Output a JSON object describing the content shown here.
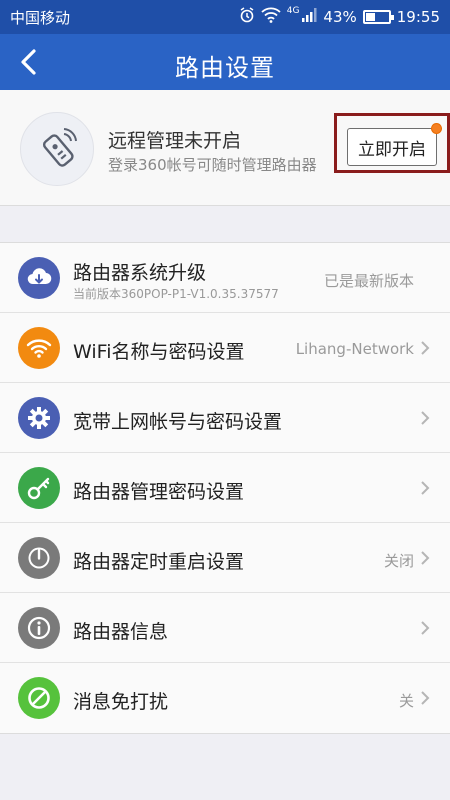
{
  "status_bar": {
    "carrier": "中国移动",
    "network": "4G",
    "battery": "43%",
    "time": "19:55"
  },
  "header": {
    "title": "路由设置"
  },
  "remote": {
    "title": "远程管理未开启",
    "subtitle": "登录360帐号可随时管理路由器",
    "button_label": "立即开启"
  },
  "settings": {
    "upgrade": {
      "label": "路由器系统升级",
      "sublabel": "当前版本360POP-P1-V1.0.35.37577",
      "value": "已是最新版本"
    },
    "wifi": {
      "label": "WiFi名称与密码设置",
      "value": "Lihang-Network"
    },
    "broadband": {
      "label": "宽带上网帐号与密码设置",
      "value": ""
    },
    "admin_password": {
      "label": "路由器管理密码设置",
      "value": ""
    },
    "scheduled_reboot": {
      "label": "路由器定时重启设置",
      "value": "关闭"
    },
    "router_info": {
      "label": "路由器信息",
      "value": ""
    },
    "dnd": {
      "label": "消息免打扰",
      "value": "关"
    }
  },
  "colors": {
    "header_blue": "#2a63c5",
    "status_blue": "#1f4fa8",
    "upgrade_icon": "#4a5fb3",
    "wifi_icon": "#f28a10",
    "broadband_icon": "#4a5fb3",
    "admin_icon": "#3ba84a",
    "reboot_icon": "#7a7a7a",
    "info_icon": "#7a7a7a",
    "dnd_icon": "#56c23c",
    "highlight_box": "#8a1c1c",
    "badge_dot": "#f57f20"
  }
}
